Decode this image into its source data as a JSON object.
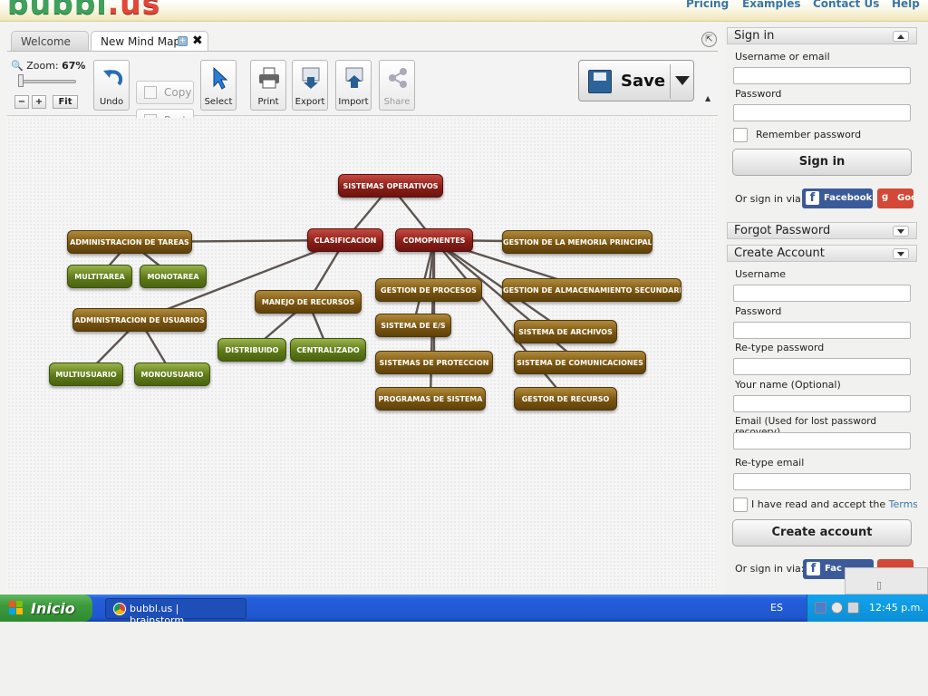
{
  "header": {
    "logo_main": "bubbl",
    "logo_suffix": ".us",
    "nav": [
      "Pricing",
      "Examples",
      "Contact Us",
      "Help"
    ]
  },
  "tabs": [
    {
      "label": "Welcome"
    },
    {
      "label": "New Mind Map"
    }
  ],
  "toolbar": {
    "zoom_label": "Zoom:",
    "zoom_value": "67%",
    "zoom_minus": "−",
    "zoom_plus": "+",
    "fit_label": "Fit",
    "undo": "Undo",
    "copy": "Copy",
    "paste": "Paste",
    "select": "Select",
    "print": "Print",
    "export": "Export",
    "import": "Import",
    "share": "Share",
    "save": "Save"
  },
  "mindmap": {
    "nodes": [
      {
        "id": "so",
        "label": "SISTEMAS OPERATIVOS",
        "color": "red"
      },
      {
        "id": "cla",
        "label": "CLASIFICACION",
        "color": "red"
      },
      {
        "id": "com",
        "label": "COMOPNENTES",
        "color": "red"
      },
      {
        "id": "adt",
        "label": "ADMINISTRACION DE TAREAS",
        "color": "brown"
      },
      {
        "id": "mul",
        "label": "MULTITAREA",
        "color": "green"
      },
      {
        "id": "mon",
        "label": "MONOTAREA",
        "color": "green"
      },
      {
        "id": "adu",
        "label": "ADMINISTRACION DE USUARIOS",
        "color": "brown"
      },
      {
        "id": "mus",
        "label": "MULTIUSUARIO",
        "color": "green"
      },
      {
        "id": "mou",
        "label": "MONOUSUARIO",
        "color": "green"
      },
      {
        "id": "mr",
        "label": "MANEJO DE RECURSOS",
        "color": "brown"
      },
      {
        "id": "dis",
        "label": "DISTRIBUIDO",
        "color": "green"
      },
      {
        "id": "cen",
        "label": "CENTRALIZADO",
        "color": "green"
      },
      {
        "id": "gmp",
        "label": "GESTION DE LA MEMORIA PRINCIPAL",
        "color": "brown"
      },
      {
        "id": "gp",
        "label": "GESTION DE PROCESOS",
        "color": "brown"
      },
      {
        "id": "gas",
        "label": "GESTION DE ALMACENAMIENTO SECUNDARIO",
        "color": "brown"
      },
      {
        "id": "ses",
        "label": "SISTEMA DE E/S",
        "color": "brown"
      },
      {
        "id": "sar",
        "label": "SISTEMA DE ARCHIVOS",
        "color": "brown"
      },
      {
        "id": "spr",
        "label": "SISTEMAS DE PROTECCION",
        "color": "brown"
      },
      {
        "id": "sco",
        "label": "SISTEMA DE COMUNICACIONES",
        "color": "brown"
      },
      {
        "id": "pds",
        "label": "PROGRAMAS DE SISTEMA",
        "color": "brown"
      },
      {
        "id": "gr",
        "label": "GESTOR DE RECURSO",
        "color": "brown"
      }
    ],
    "edges": [
      [
        "so",
        "cla"
      ],
      [
        "so",
        "com"
      ],
      [
        "cla",
        "adt"
      ],
      [
        "cla",
        "adu"
      ],
      [
        "cla",
        "mr"
      ],
      [
        "adt",
        "mul"
      ],
      [
        "adt",
        "mon"
      ],
      [
        "adu",
        "mus"
      ],
      [
        "adu",
        "mou"
      ],
      [
        "mr",
        "dis"
      ],
      [
        "mr",
        "cen"
      ],
      [
        "com",
        "gmp"
      ],
      [
        "com",
        "gp"
      ],
      [
        "com",
        "gas"
      ],
      [
        "com",
        "ses"
      ],
      [
        "com",
        "sar"
      ],
      [
        "com",
        "spr"
      ],
      [
        "com",
        "sco"
      ],
      [
        "com",
        "pds"
      ],
      [
        "com",
        "gr"
      ]
    ]
  },
  "panel": {
    "signin_header": "Sign in",
    "username_or_email": "Username or email",
    "password": "Password",
    "remember": "Remember password",
    "signin_button": "Sign in",
    "or_signin_via": "Or sign in via:",
    "facebook": "Facebook",
    "google": "Goo",
    "forgot_header": "Forgot Password",
    "create_header": "Create Account",
    "username": "Username",
    "password2": "Password",
    "retype_password": "Re-type password",
    "your_name": "Your name (Optional)",
    "email": "Email (Used for lost password recovery)",
    "retype_email": "Re-type email",
    "terms_text": "I have read and accept the ",
    "terms_link": "Terms of",
    "create_button": "Create account",
    "or_signin_via2": "Or sign in via:",
    "facebook2": "Fac"
  },
  "taskbar": {
    "start": "Inicio",
    "task_label": "bubbl.us | brainstorm...",
    "lang": "ES",
    "clock": "12:45 p.m."
  },
  "colors": {
    "logo_green": "#3fa15c",
    "logo_red": "#e2473a",
    "link_blue": "#3a76a8",
    "taskbar_blue": "#245edb",
    "start_green": "#3d9a3d"
  }
}
